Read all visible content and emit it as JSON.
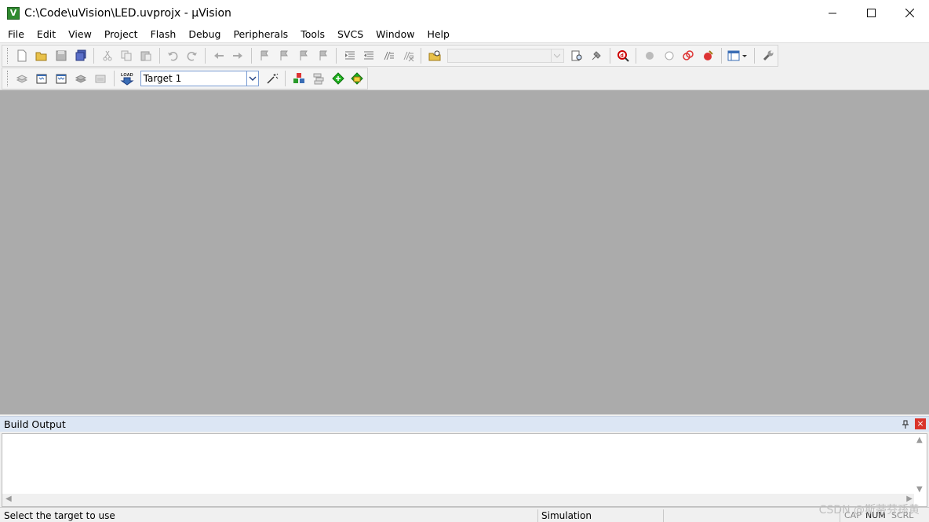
{
  "window": {
    "title": "C:\\Code\\uVision\\LED.uvprojx - µVision",
    "app_icon_glyph": "V"
  },
  "menu": [
    "File",
    "Edit",
    "View",
    "Project",
    "Flash",
    "Debug",
    "Peripherals",
    "Tools",
    "SVCS",
    "Window",
    "Help"
  ],
  "toolbar": {
    "target": "Target 1",
    "load_label": "LOAD"
  },
  "build_output": {
    "title": "Build Output",
    "close_glyph": "×",
    "content": ""
  },
  "statusbar": {
    "message": "Select the target to use",
    "mode": "Simulation",
    "indicators": [
      "CAP",
      "NUM",
      "SCRL"
    ]
  },
  "watermark": "CSDN @斯蒂芬孫黄",
  "colors": {
    "workspace": "#ababab",
    "panel_header": "#dce6f4",
    "close_button": "#d9342b"
  }
}
